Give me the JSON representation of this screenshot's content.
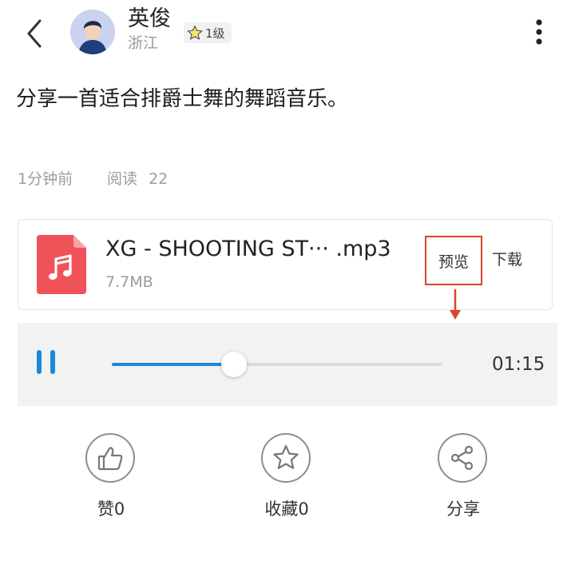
{
  "header": {
    "username": "英俊",
    "location": "浙江",
    "level": "1级"
  },
  "post": {
    "text": "分享一首适合排爵士舞的舞蹈音乐。",
    "time": "1分钟前",
    "read_label": "阅读",
    "read_count": "22"
  },
  "file": {
    "name": "XG - SHOOTING ST··· .mp3",
    "size": "7.7MB",
    "preview_label": "预览",
    "download_label": "下载"
  },
  "player": {
    "time": "01:15",
    "progress": 0.37
  },
  "actions": [
    {
      "label": "赞",
      "count": "0"
    },
    {
      "label": "收藏",
      "count": "0"
    },
    {
      "label": "分享"
    }
  ],
  "colors": {
    "accent_blue": "#1e88d8",
    "file_icon": "#f0525a",
    "highlight_red": "#d9452a"
  }
}
